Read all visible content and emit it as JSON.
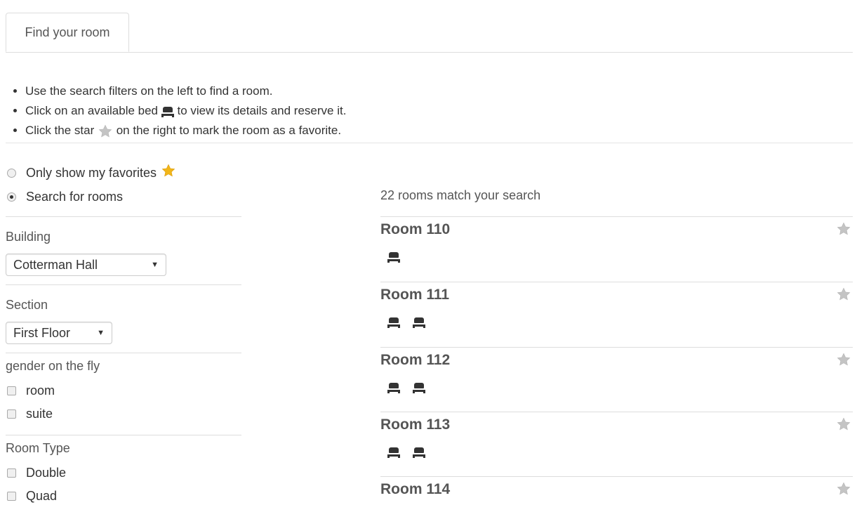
{
  "tabs": [
    {
      "label": "Find your room",
      "active": true
    }
  ],
  "instructions": {
    "line1": "Use the search filters on the left to find a room.",
    "line2_before": "Click on an available bed",
    "line2_after": "to view its details and reserve it.",
    "line3_before": "Click the star",
    "line3_after": "on the right to mark the room as a favorite."
  },
  "filters": {
    "favorites_label": "Only show my favorites",
    "search_label": "Search for rooms",
    "mode_selected": "search",
    "building": {
      "label": "Building",
      "value": "Cotterman Hall"
    },
    "section": {
      "label": "Section",
      "value": "First Floor"
    },
    "gender": {
      "label": "gender on the fly",
      "options": [
        "room",
        "suite"
      ]
    },
    "room_type": {
      "label": "Room Type",
      "options": [
        "Double",
        "Quad"
      ]
    }
  },
  "results": {
    "count_text": "22 rooms match your search",
    "rooms": [
      {
        "name": "Room 110",
        "beds": 1
      },
      {
        "name": "Room 111",
        "beds": 2
      },
      {
        "name": "Room 112",
        "beds": 2
      },
      {
        "name": "Room 113",
        "beds": 2
      },
      {
        "name": "Room 114",
        "beds": 0
      }
    ]
  },
  "icons": {
    "bed": "bed-icon",
    "star_gray": "star-gray-icon",
    "star_gold": "star-gold-icon"
  },
  "colors": {
    "text": "#333333",
    "muted": "#555555",
    "border": "#dddddd",
    "star_gold": "#f2b619",
    "star_gray": "#c4c4c4"
  }
}
